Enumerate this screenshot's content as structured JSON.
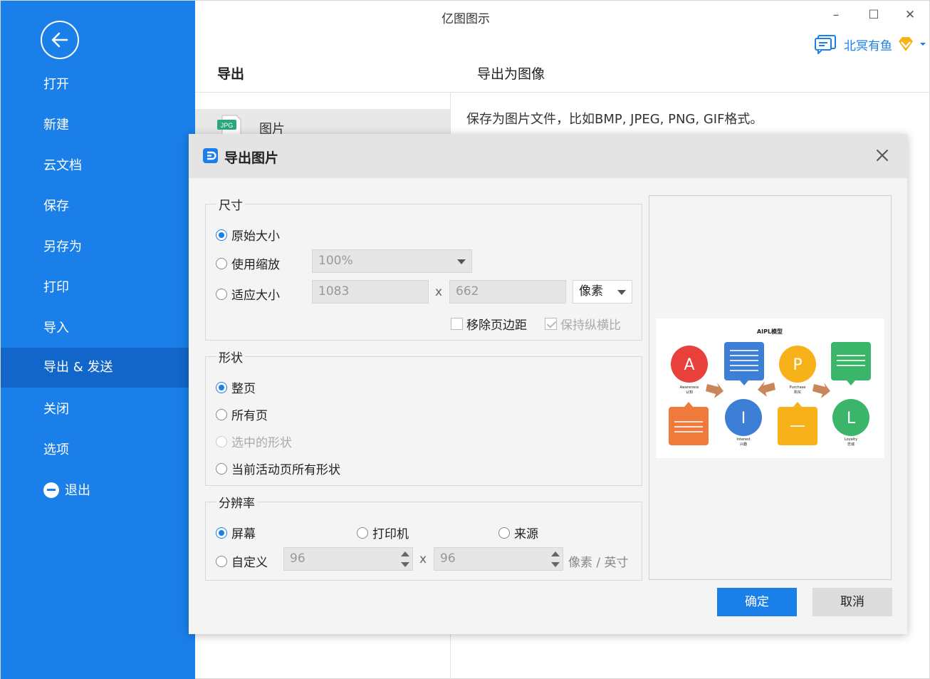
{
  "app": {
    "title": "亿图图示"
  },
  "window": {
    "minimize": "–",
    "maximize": "☐",
    "close": "✕"
  },
  "user": {
    "name": "北冥有鱼"
  },
  "sidebar": {
    "items": [
      {
        "label": "打开"
      },
      {
        "label": "新建"
      },
      {
        "label": "云文档"
      },
      {
        "label": "保存"
      },
      {
        "label": "另存为"
      },
      {
        "label": "打印"
      },
      {
        "label": "导入"
      },
      {
        "label": "导出 & 发送",
        "active": true
      },
      {
        "label": "关闭"
      },
      {
        "label": "选项"
      },
      {
        "label": "退出"
      }
    ]
  },
  "export_panel": {
    "header": "导出",
    "right_header": "导出为图像",
    "format": {
      "icon_text": "JPG",
      "label": "图片"
    },
    "description": "保存为图片文件，比如BMP, JPEG, PNG, GIF格式。"
  },
  "dialog": {
    "title": "导出图片",
    "size_group": {
      "title": "尺寸",
      "original": "原始大小",
      "use_zoom": "使用缩放",
      "zoom_value": "100%",
      "fit_size": "适应大小",
      "width": "1083",
      "height": "662",
      "times": "x",
      "unit": "像素",
      "remove_margin": "移除页边距",
      "keep_ratio": "保持纵横比"
    },
    "shape_group": {
      "title": "形状",
      "whole_page": "整页",
      "all_pages": "所有页",
      "selected": "选中的形状",
      "current_all": "当前活动页所有形状"
    },
    "resolution_group": {
      "title": "分辨率",
      "screen": "屏幕",
      "printer": "打印机",
      "source": "来源",
      "custom": "自定义",
      "dpi_x": "96",
      "dpi_y": "96",
      "times": "x",
      "unit": "像素 / 英寸"
    },
    "ok": "确定",
    "cancel": "取消"
  },
  "preview": {
    "title": "AIPL模型",
    "nodes": [
      {
        "letter": "A",
        "en": "Awareness",
        "cn": "认知",
        "color": "#e8413c"
      },
      {
        "letter": "I",
        "en": "Interest",
        "cn": "兴趣",
        "color": "#3d7fd6"
      },
      {
        "letter": "P",
        "en": "Purchase",
        "cn": "购买",
        "color": "#f7b21a"
      },
      {
        "letter": "L",
        "en": "Loyalty",
        "cn": "忠诚",
        "color": "#3bb56a"
      }
    ],
    "card_colors": {
      "orange": "#f07a3c",
      "blue": "#3d7fd6",
      "yellow": "#f7b21a",
      "green": "#3bb56a"
    }
  },
  "colors": {
    "accent": "#1a7fe8",
    "sidebar_active": "#1266c9"
  }
}
